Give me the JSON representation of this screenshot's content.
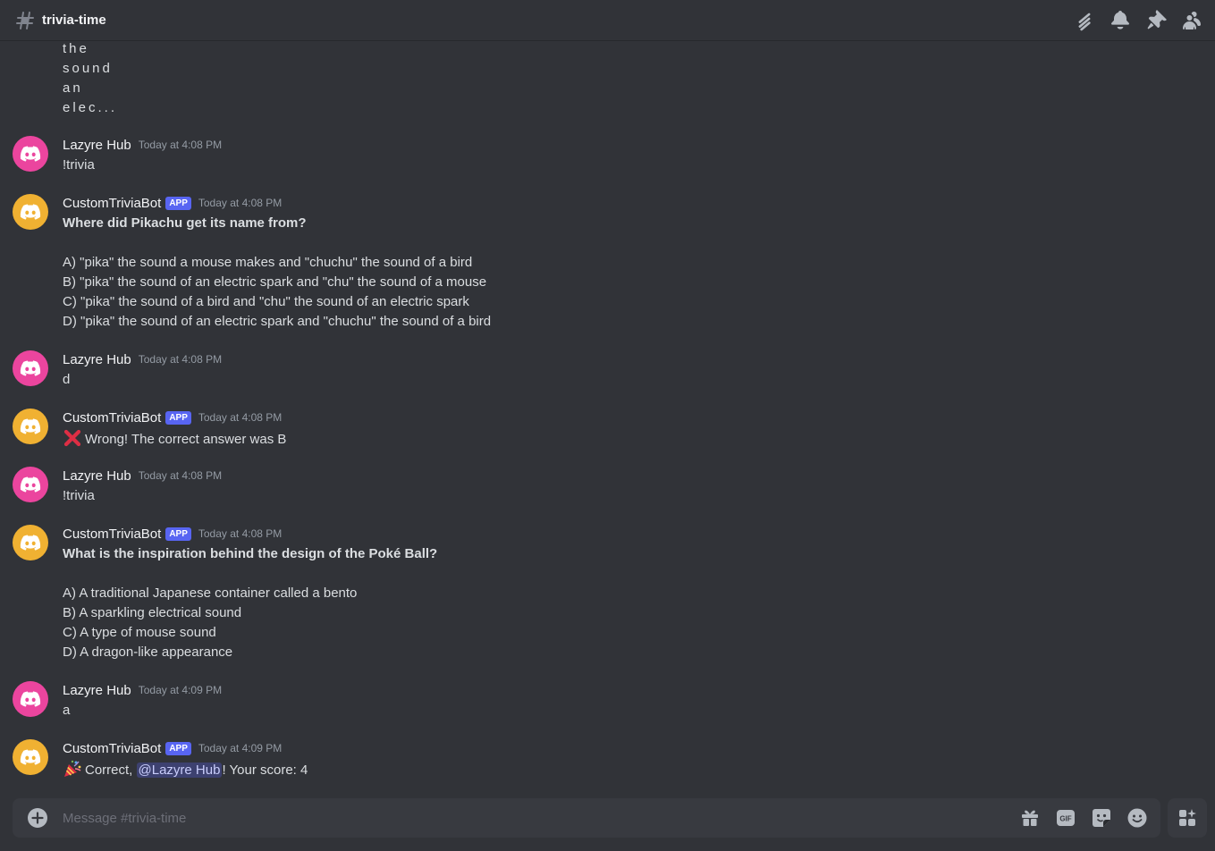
{
  "header": {
    "channel_name": "trivia-time"
  },
  "fragment_lines": [
    "the",
    "sound",
    "an",
    "elec..."
  ],
  "messages": [
    {
      "author": "Lazyre Hub",
      "timestamp": "Today at 4:08 PM",
      "lines": [
        "!trivia"
      ]
    },
    {
      "author": "CustomTriviaBot",
      "badge": "APP",
      "timestamp": "Today at 4:08 PM",
      "question": "Where did Pikachu get its name from?",
      "options": [
        "A) \"pika\" the sound a mouse makes and \"chuchu\" the sound of a bird",
        "B) \"pika\" the sound of an electric spark and \"chu\" the sound of a mouse",
        "C) \"pika\" the sound of a bird and \"chu\" the sound of an electric spark",
        "D) \"pika\" the sound of an electric spark and \"chuchu\" the sound of a bird"
      ]
    },
    {
      "author": "Lazyre Hub",
      "timestamp": "Today at 4:08 PM",
      "lines": [
        "d"
      ]
    },
    {
      "author": "CustomTriviaBot",
      "badge": "APP",
      "timestamp": "Today at 4:08 PM",
      "text": "Wrong! The correct answer was B",
      "emoji": "cross-mark"
    },
    {
      "author": "Lazyre Hub",
      "timestamp": "Today at 4:08 PM",
      "lines": [
        "!trivia"
      ]
    },
    {
      "author": "CustomTriviaBot",
      "badge": "APP",
      "timestamp": "Today at 4:08 PM",
      "question": "What is the inspiration behind the design of the Poké Ball?",
      "options": [
        "A) A traditional Japanese container called a bento",
        "B) A sparkling electrical sound",
        "C) A type of mouse sound",
        "D) A dragon-like appearance"
      ]
    },
    {
      "author": "Lazyre Hub",
      "timestamp": "Today at 4:09 PM",
      "lines": [
        "a"
      ]
    },
    {
      "author": "CustomTriviaBot",
      "badge": "APP",
      "timestamp": "Today at 4:09 PM",
      "text_before": "Correct, ",
      "mention": "@Lazyre Hub",
      "text_after": "! Your score: 4",
      "emoji": "party-popper"
    }
  ],
  "composer": {
    "placeholder": "Message #trivia-time"
  },
  "icons": {
    "header": [
      "threads-icon",
      "bell-icon",
      "pin-icon",
      "members-icon"
    ],
    "composer": [
      "gift-icon",
      "gif-icon",
      "sticker-icon",
      "emoji-icon"
    ],
    "apps": "apps-icon"
  },
  "colors": {
    "background": "#313338",
    "composer": "#383a40",
    "user_avatar": "#eb459e",
    "bot_avatar": "#f0b132",
    "badge": "#5865f2",
    "mention_bg": "#3c4270"
  }
}
